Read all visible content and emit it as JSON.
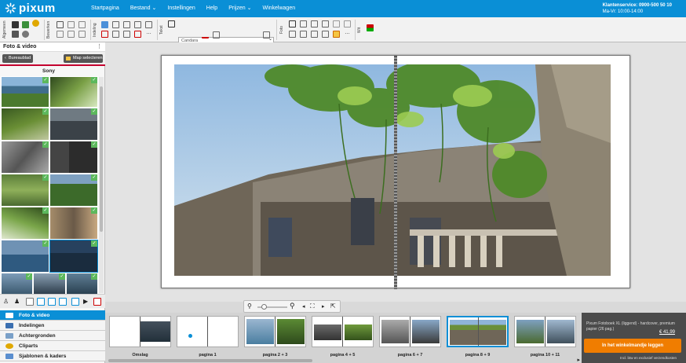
{
  "header": {
    "logo_text": "pixum",
    "menu": [
      "Startpagina",
      "Bestand",
      "Instellingen",
      "Help",
      "Prijzen",
      "Winkelwagen"
    ],
    "service_line1": "Klantenservice: 0900-500 50 10",
    "service_line2": "Ma-Vr: 10:00-14:00"
  },
  "toolbar": {
    "groups": [
      "Algemeen",
      "Bewerken",
      "Indeling",
      "Tekst",
      "Foto",
      "Wit"
    ],
    "font_value": "Candara",
    "font_size": "11",
    "bold": "B",
    "italic": "I",
    "underline": "U",
    "grow_font": "A",
    "shrink_font": "A"
  },
  "sidebar": {
    "title": "Foto & video",
    "back_button": "Bureaublad",
    "folder_button": "Map selecteren",
    "folder_name": "Sony",
    "nav": [
      "Foto & video",
      "Indelingen",
      "Achtergronden",
      "Cliparts",
      "Sjablonen & kaders"
    ]
  },
  "filmstrip": {
    "pages": [
      "Omslag",
      "pagina 1",
      "pagina 2 + 3",
      "pagina 4 + 5",
      "pagina 6 + 7",
      "pagina 8 + 9",
      "pagina 10 + 11"
    ],
    "selected_index": 5
  },
  "order": {
    "description": "Pixum Fotoboek XL (liggend) - hardcover, premium papier (26 pag.)",
    "price": "€ 41,99",
    "cart_button": "In het winkelmandje leggen",
    "shipping": "Incl. btw en exclusief verzendkosten"
  }
}
